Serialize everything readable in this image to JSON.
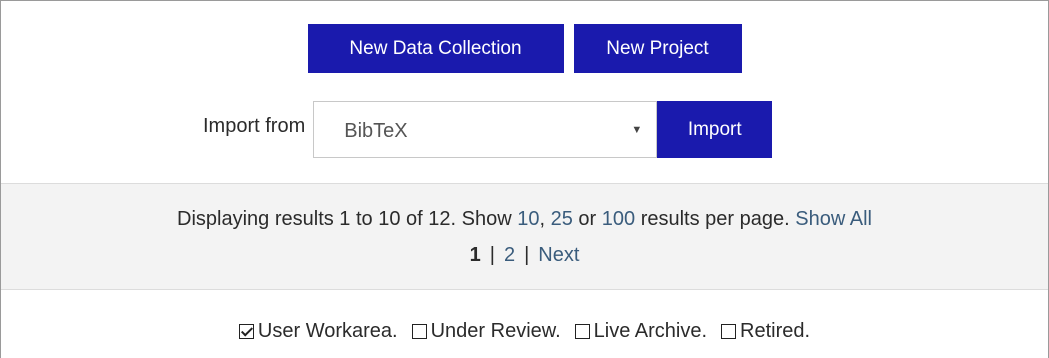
{
  "actions": {
    "new_data_collection_label": "New Data Collection",
    "new_project_label": "New Project"
  },
  "import": {
    "label": "Import from",
    "selected": "BibTeX",
    "button_label": "Import"
  },
  "results": {
    "prefix": "Displaying results 1 to 10 of 12. Show",
    "opt_10": "10",
    "comma": ",",
    "opt_25": "25",
    "or": "or",
    "opt_100": "100",
    "suffix": "results per page.",
    "show_all": "Show All"
  },
  "pager": {
    "current": "1",
    "sep": "|",
    "page2": "2",
    "next": "Next"
  },
  "filters": [
    {
      "label": "User Workarea.",
      "checked": true
    },
    {
      "label": "Under Review.",
      "checked": false
    },
    {
      "label": "Live Archive.",
      "checked": false
    },
    {
      "label": "Retired.",
      "checked": false
    }
  ],
  "colors": {
    "button_bg": "#1a1aad",
    "link": "#3a5c7c",
    "band_bg": "#f3f3f3"
  }
}
